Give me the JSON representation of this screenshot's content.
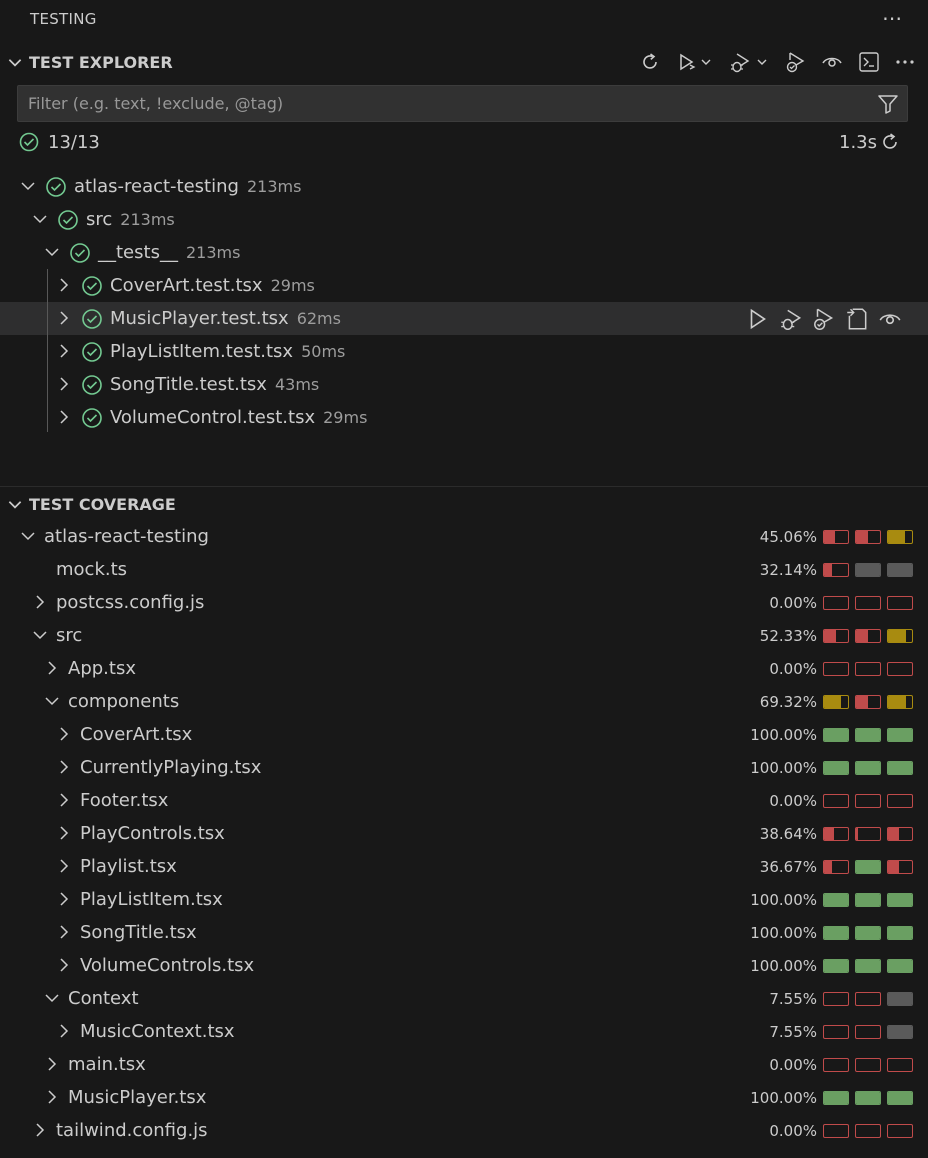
{
  "panel": {
    "title": "TESTING",
    "more_icon": "ellipsis-icon"
  },
  "explorer": {
    "header": "TEST EXPLORER",
    "toolbar_icons": [
      "refresh-icon",
      "run-all-icon",
      "debug-all-icon",
      "run-coverage-icon",
      "watch-icon",
      "terminal-icon",
      "more-icon"
    ],
    "filter_placeholder": "Filter (e.g. text, !exclude, @tag)",
    "summary": {
      "count": "13/13",
      "duration": "1.3s"
    },
    "tree": [
      {
        "label": "atlas-react-testing",
        "duration": "213ms",
        "expanded": true,
        "level": 0
      },
      {
        "label": "src",
        "duration": "213ms",
        "expanded": true,
        "level": 1
      },
      {
        "label": "__tests__",
        "duration": "213ms",
        "expanded": true,
        "level": 2
      },
      {
        "label": "CoverArt.test.tsx",
        "duration": "29ms",
        "expanded": false,
        "level": 3
      },
      {
        "label": "MusicPlayer.test.tsx",
        "duration": "62ms",
        "expanded": false,
        "level": 3,
        "selected": true
      },
      {
        "label": "PlayListItem.test.tsx",
        "duration": "50ms",
        "expanded": false,
        "level": 3
      },
      {
        "label": "SongTitle.test.tsx",
        "duration": "43ms",
        "expanded": false,
        "level": 3
      },
      {
        "label": "VolumeControl.test.tsx",
        "duration": "29ms",
        "expanded": false,
        "level": 3
      }
    ],
    "row_actions": [
      "run-test-icon",
      "debug-test-icon",
      "run-coverage-icon",
      "go-to-file-icon",
      "watch-icon"
    ]
  },
  "coverage": {
    "header": "TEST COVERAGE",
    "colors": {
      "red": "#c04b4b",
      "yellow": "#a88b10",
      "green": "#6a9f62",
      "gray": "#5a5a5a"
    },
    "rows": [
      {
        "label": "atlas-react-testing",
        "level": 0,
        "chevron": "down",
        "pct": "45.06%",
        "bars": [
          {
            "c": "red",
            "f": 0.45
          },
          {
            "c": "red",
            "f": 0.5
          },
          {
            "c": "yellow",
            "f": 0.7
          }
        ]
      },
      {
        "label": "mock.ts",
        "level": 1,
        "chevron": "none",
        "pct": "32.14%",
        "bars": [
          {
            "c": "red",
            "f": 0.35
          },
          {
            "c": "gray",
            "f": 1
          },
          {
            "c": "gray",
            "f": 1
          }
        ]
      },
      {
        "label": "postcss.config.js",
        "level": 1,
        "chevron": "right",
        "pct": "0.00%",
        "bars": [
          {
            "c": "red",
            "f": 0
          },
          {
            "c": "red",
            "f": 0
          },
          {
            "c": "red",
            "f": 0
          }
        ]
      },
      {
        "label": "src",
        "level": 1,
        "chevron": "down",
        "pct": "52.33%",
        "bars": [
          {
            "c": "red",
            "f": 0.5
          },
          {
            "c": "red",
            "f": 0.5
          },
          {
            "c": "yellow",
            "f": 0.75
          }
        ]
      },
      {
        "label": "App.tsx",
        "level": 2,
        "chevron": "right",
        "pct": "0.00%",
        "bars": [
          {
            "c": "red",
            "f": 0
          },
          {
            "c": "red",
            "f": 0
          },
          {
            "c": "red",
            "f": 0
          }
        ]
      },
      {
        "label": "components",
        "level": 2,
        "chevron": "down",
        "pct": "69.32%",
        "bars": [
          {
            "c": "yellow",
            "f": 0.7
          },
          {
            "c": "red",
            "f": 0.5
          },
          {
            "c": "yellow",
            "f": 0.75
          }
        ]
      },
      {
        "label": "CoverArt.tsx",
        "level": 3,
        "chevron": "right",
        "pct": "100.00%",
        "bars": [
          {
            "c": "green",
            "f": 1
          },
          {
            "c": "green",
            "f": 1
          },
          {
            "c": "green",
            "f": 1
          }
        ]
      },
      {
        "label": "CurrentlyPlaying.tsx",
        "level": 3,
        "chevron": "right",
        "pct": "100.00%",
        "bars": [
          {
            "c": "green",
            "f": 1
          },
          {
            "c": "green",
            "f": 1
          },
          {
            "c": "green",
            "f": 1
          }
        ]
      },
      {
        "label": "Footer.tsx",
        "level": 3,
        "chevron": "right",
        "pct": "0.00%",
        "bars": [
          {
            "c": "red",
            "f": 0
          },
          {
            "c": "red",
            "f": 0
          },
          {
            "c": "red",
            "f": 0
          }
        ]
      },
      {
        "label": "PlayControls.tsx",
        "level": 3,
        "chevron": "right",
        "pct": "38.64%",
        "bars": [
          {
            "c": "red",
            "f": 0.4
          },
          {
            "c": "red",
            "f": 0.1
          },
          {
            "c": "red",
            "f": 0.45
          }
        ]
      },
      {
        "label": "Playlist.tsx",
        "level": 3,
        "chevron": "right",
        "pct": "36.67%",
        "bars": [
          {
            "c": "red",
            "f": 0.35
          },
          {
            "c": "green",
            "f": 1
          },
          {
            "c": "red",
            "f": 0.45
          }
        ]
      },
      {
        "label": "PlayListItem.tsx",
        "level": 3,
        "chevron": "right",
        "pct": "100.00%",
        "bars": [
          {
            "c": "green",
            "f": 1
          },
          {
            "c": "green",
            "f": 1
          },
          {
            "c": "green",
            "f": 1
          }
        ]
      },
      {
        "label": "SongTitle.tsx",
        "level": 3,
        "chevron": "right",
        "pct": "100.00%",
        "bars": [
          {
            "c": "green",
            "f": 1
          },
          {
            "c": "green",
            "f": 1
          },
          {
            "c": "green",
            "f": 1
          }
        ]
      },
      {
        "label": "VolumeControls.tsx",
        "level": 3,
        "chevron": "right",
        "pct": "100.00%",
        "bars": [
          {
            "c": "green",
            "f": 1
          },
          {
            "c": "green",
            "f": 1
          },
          {
            "c": "green",
            "f": 1
          }
        ]
      },
      {
        "label": "Context",
        "level": 2,
        "chevron": "down",
        "pct": "7.55%",
        "bars": [
          {
            "c": "red",
            "f": 0
          },
          {
            "c": "red",
            "f": 0
          },
          {
            "c": "gray",
            "f": 1
          }
        ]
      },
      {
        "label": "MusicContext.tsx",
        "level": 3,
        "chevron": "right",
        "pct": "7.55%",
        "bars": [
          {
            "c": "red",
            "f": 0
          },
          {
            "c": "red",
            "f": 0
          },
          {
            "c": "gray",
            "f": 1
          }
        ]
      },
      {
        "label": "main.tsx",
        "level": 2,
        "chevron": "right",
        "pct": "0.00%",
        "bars": [
          {
            "c": "red",
            "f": 0
          },
          {
            "c": "red",
            "f": 0
          },
          {
            "c": "red",
            "f": 0
          }
        ]
      },
      {
        "label": "MusicPlayer.tsx",
        "level": 2,
        "chevron": "right",
        "pct": "100.00%",
        "bars": [
          {
            "c": "green",
            "f": 1
          },
          {
            "c": "green",
            "f": 1
          },
          {
            "c": "green",
            "f": 1
          }
        ]
      },
      {
        "label": "tailwind.config.js",
        "level": 1,
        "chevron": "right",
        "pct": "0.00%",
        "bars": [
          {
            "c": "red",
            "f": 0
          },
          {
            "c": "red",
            "f": 0
          },
          {
            "c": "red",
            "f": 0
          }
        ]
      }
    ]
  }
}
